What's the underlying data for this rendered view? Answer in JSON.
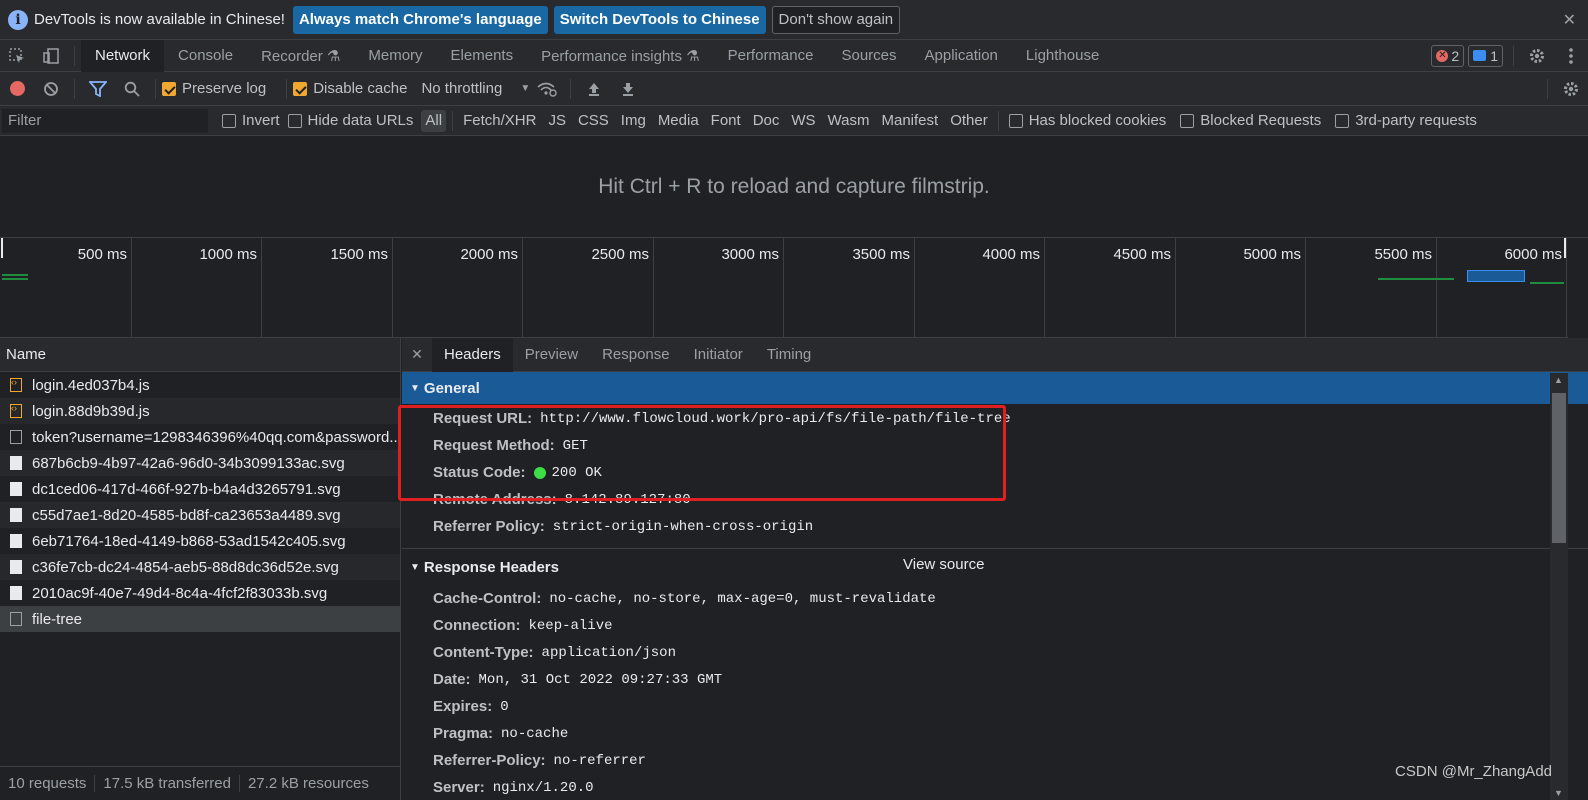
{
  "infobar": {
    "message": "DevTools is now available in Chinese!",
    "btn_match": "Always match Chrome's language",
    "btn_switch": "Switch DevTools to Chinese",
    "btn_dismiss": "Don't show again",
    "close": "✕"
  },
  "tabs": [
    {
      "label": "Network",
      "active": true
    },
    {
      "label": "Console"
    },
    {
      "label": "Recorder ⚗"
    },
    {
      "label": "Memory"
    },
    {
      "label": "Elements"
    },
    {
      "label": "Performance insights ⚗"
    },
    {
      "label": "Performance"
    },
    {
      "label": "Sources"
    },
    {
      "label": "Application"
    },
    {
      "label": "Lighthouse"
    }
  ],
  "badges": {
    "errors": "2",
    "messages": "1",
    "error_glyph": "✕"
  },
  "toolbar": {
    "preserve_log": "Preserve log",
    "disable_cache": "Disable cache",
    "throttling": "No throttling",
    "throttling_caret": "▼"
  },
  "filterbar": {
    "placeholder": "Filter",
    "invert": "Invert",
    "hide_data_urls": "Hide data URLs",
    "types": [
      "All",
      "Fetch/XHR",
      "JS",
      "CSS",
      "Img",
      "Media",
      "Font",
      "Doc",
      "WS",
      "Wasm",
      "Manifest",
      "Other"
    ],
    "has_blocked_cookies": "Has blocked cookies",
    "blocked_requests": "Blocked Requests",
    "third_party": "3rd-party requests"
  },
  "filmstrip_message": "Hit Ctrl + R to reload and capture filmstrip.",
  "overview": {
    "ticks": [
      "500 ms",
      "1000 ms",
      "1500 ms",
      "2000 ms",
      "2500 ms",
      "3000 ms",
      "3500 ms",
      "4000 ms",
      "4500 ms",
      "5000 ms",
      "5500 ms",
      "6000 ms"
    ]
  },
  "requests": {
    "column": "Name",
    "items": [
      {
        "name": "login.4ed037b4.js",
        "type": "js"
      },
      {
        "name": "login.88d9b39d.js",
        "type": "js"
      },
      {
        "name": "token?username=1298346396%40qq.com&password...",
        "type": "doc"
      },
      {
        "name": "687b6cb9-4b97-42a6-96d0-34b3099133ac.svg",
        "type": "img"
      },
      {
        "name": "dc1ced06-417d-466f-927b-b4a4d3265791.svg",
        "type": "img"
      },
      {
        "name": "c55d7ae1-8d20-4585-bd8f-ca23653a4489.svg",
        "type": "img"
      },
      {
        "name": "6eb71764-18ed-4149-b868-53ad1542c405.svg",
        "type": "img"
      },
      {
        "name": "c36fe7cb-dc24-4854-aeb5-88d8dc36d52e.svg",
        "type": "img"
      },
      {
        "name": "2010ac9f-40e7-49d4-8c4a-4fcf2f83033b.svg",
        "type": "img"
      },
      {
        "name": "file-tree",
        "type": "doc",
        "selected": true
      }
    ]
  },
  "status": {
    "requests": "10 requests",
    "transferred": "17.5 kB transferred",
    "resources": "27.2 kB resources"
  },
  "detail": {
    "close": "✕",
    "tabs": [
      "Headers",
      "Preview",
      "Response",
      "Initiator",
      "Timing"
    ],
    "general_title": "General",
    "general": [
      {
        "k": "Request URL:",
        "v": "http://www.flowcloud.work/pro-api/fs/file-path/file-tree"
      },
      {
        "k": "Request Method:",
        "v": "GET"
      },
      {
        "k": "Status Code:",
        "v": "200 OK"
      },
      {
        "k": "Remote Address:",
        "v": "8.142.89.127:80"
      },
      {
        "k": "Referrer Policy:",
        "v": "strict-origin-when-cross-origin"
      }
    ],
    "response_title": "Response Headers",
    "view_source": "View source",
    "response": [
      {
        "k": "Cache-Control:",
        "v": "no-cache, no-store, max-age=0, must-revalidate"
      },
      {
        "k": "Connection:",
        "v": "keep-alive"
      },
      {
        "k": "Content-Type:",
        "v": "application/json"
      },
      {
        "k": "Date:",
        "v": "Mon, 31 Oct 2022 09:27:33 GMT"
      },
      {
        "k": "Expires:",
        "v": "0"
      },
      {
        "k": "Pragma:",
        "v": "no-cache"
      },
      {
        "k": "Referrer-Policy:",
        "v": "no-referrer"
      },
      {
        "k": "Server:",
        "v": "nginx/1.20.0"
      }
    ]
  },
  "watermark": "CSDN @Mr_ZhangAdd",
  "colors": {
    "accent": "#1a5a96",
    "error": "#e46962",
    "ok": "#3cdd45",
    "highlight": "#e02020"
  }
}
